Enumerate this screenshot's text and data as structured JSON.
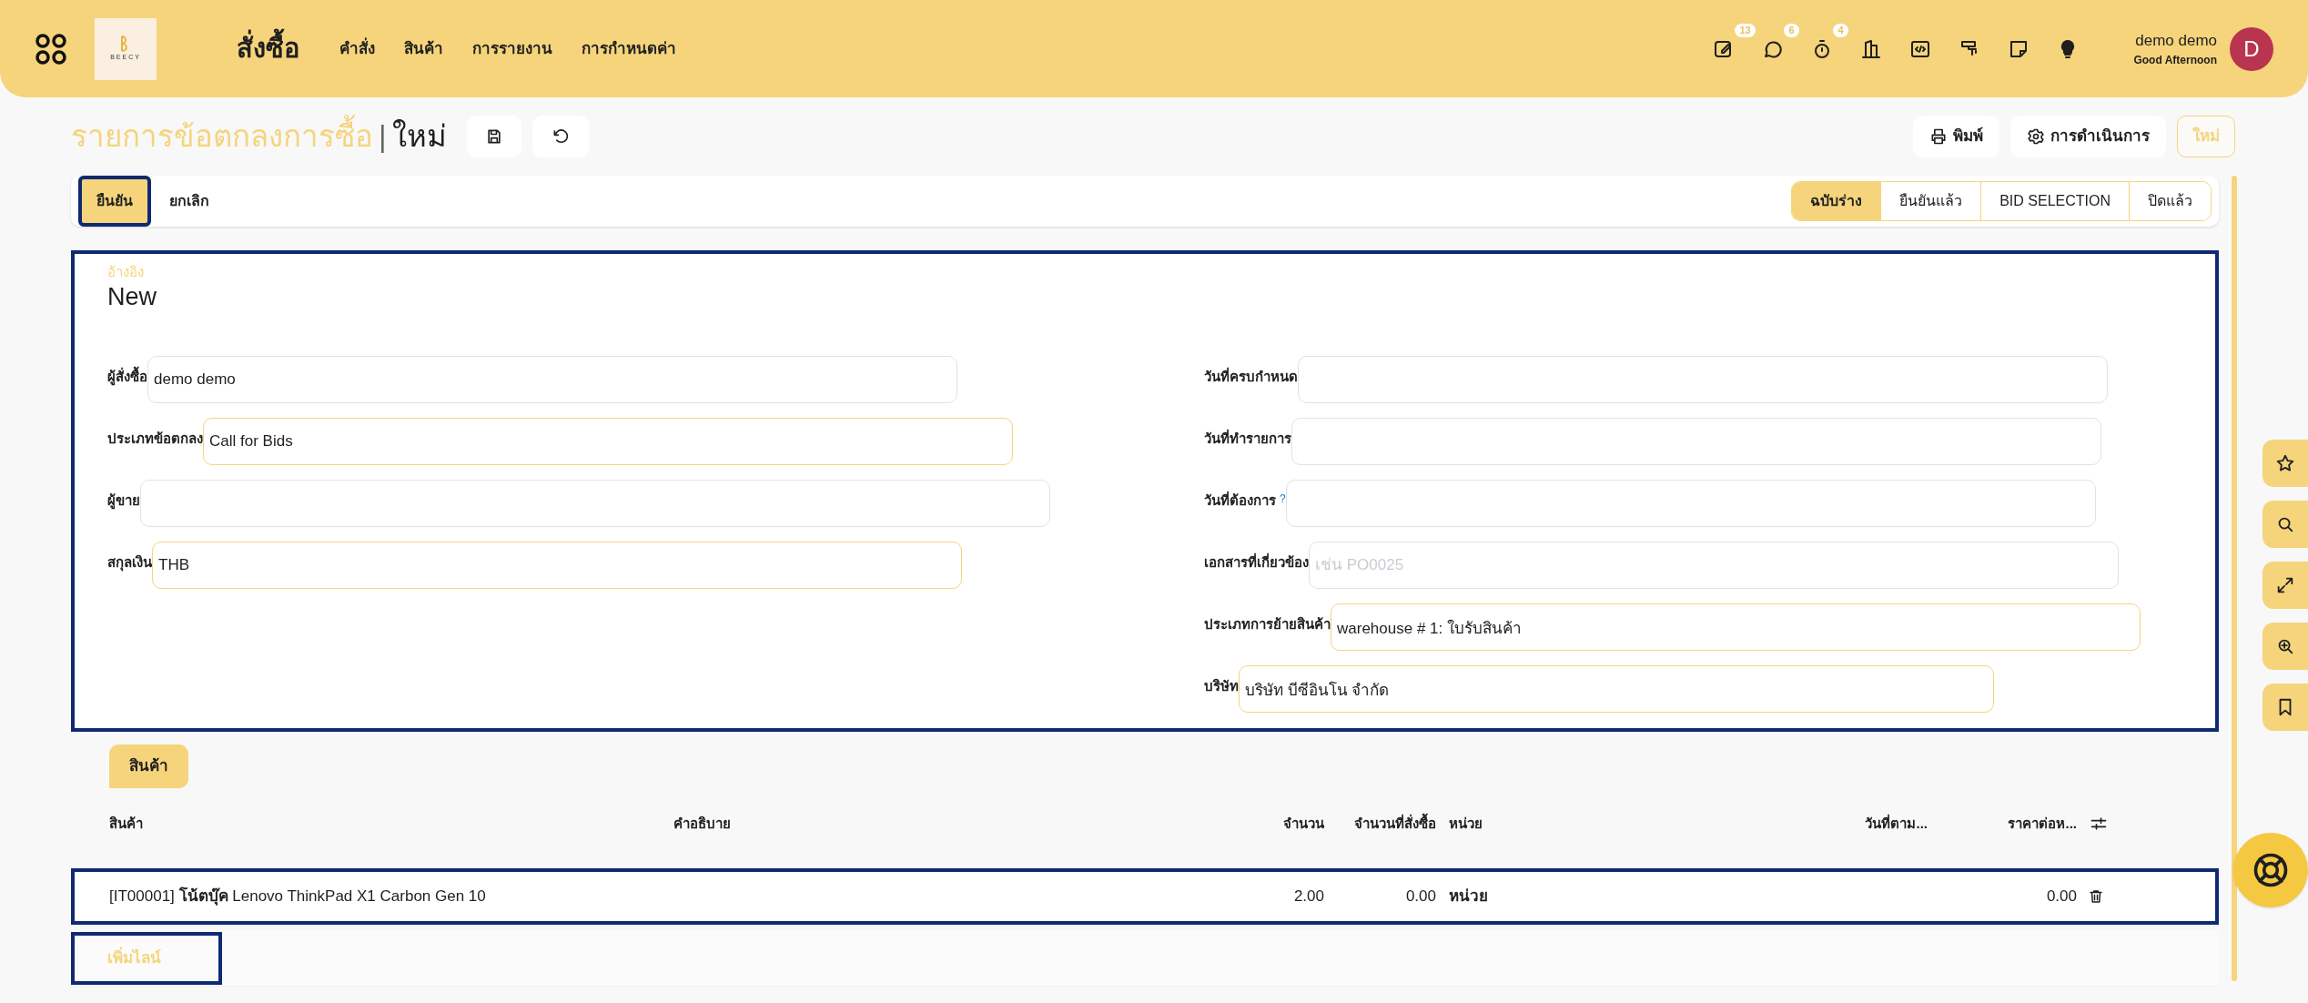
{
  "topbar": {
    "app_title": "สั่งซื้อ",
    "logo_text": "BEECY",
    "menu": [
      "คำสั่ง",
      "สินค้า",
      "การรายงาน",
      "การกำหนดค่า"
    ],
    "icons": [
      {
        "kind": "edit",
        "badge": "13"
      },
      {
        "kind": "chat",
        "badge": "6"
      },
      {
        "kind": "timer",
        "badge": "4"
      },
      {
        "kind": "building"
      },
      {
        "kind": "code"
      },
      {
        "kind": "paint"
      },
      {
        "kind": "note"
      },
      {
        "kind": "bulb"
      }
    ],
    "user": {
      "name": "demo demo",
      "greeting": "Good Afternoon",
      "initial": "D"
    }
  },
  "breadcrumb": {
    "parent": "รายการข้อตกลงการซื้อ",
    "separator": "|",
    "current": "ใหม่"
  },
  "actions": [
    {
      "kind": "print",
      "label": "พิมพ์"
    },
    {
      "kind": "gear",
      "label": "การดำเนินการ"
    },
    {
      "kind": "new",
      "label": "ใหม่"
    }
  ],
  "status_bar": {
    "buttons": [
      {
        "label": "ยืนยัน",
        "primary": true,
        "highlighted": true
      },
      {
        "label": "ยกเลิก",
        "primary": false,
        "highlighted": false
      }
    ],
    "stages": [
      {
        "label": "ฉบับร่าง",
        "selected": true
      },
      {
        "label": "ยืนยันแล้ว",
        "selected": false
      },
      {
        "label": "BID SELECTION",
        "selected": false
      },
      {
        "label": "ปิดแล้ว",
        "selected": false
      }
    ]
  },
  "form": {
    "highlighted": true,
    "reference_label": "อ้างอิง",
    "reference": "New",
    "left_fields": [
      {
        "label": "ผู้สั่งซื้อ",
        "value": "demo demo",
        "required": false
      },
      {
        "label": "ประเภทข้อตกลง",
        "value": "Call for Bids",
        "required": true
      },
      {
        "label": "ผู้ขาย",
        "required": false
      },
      {
        "label": "สกุลเงิน",
        "value": "THB",
        "required": true
      }
    ],
    "right_fields": [
      {
        "label": "วันที่ครบกำหนด",
        "required": false
      },
      {
        "label": "วันที่ทำรายการ",
        "required": false
      },
      {
        "label": "วันที่ต้องการ",
        "help_mark": "?",
        "required": false
      },
      {
        "label": "เอกสารที่เกี่ยวข้อง",
        "placeholder": "เช่น PO0025",
        "required": false
      },
      {
        "label": "ประเภทการย้ายสินค้า",
        "value": "warehouse # 1: ใบรับสินค้า",
        "required": true
      },
      {
        "label": "บริษัท",
        "value": "บริษัท บีซีอินโน จำกัด",
        "required": true
      }
    ]
  },
  "tabs": [
    {
      "label": "สินค้า",
      "selected": true
    }
  ],
  "table": {
    "columns": [
      "สินค้า",
      "คำอธิบาย",
      "จำนวน",
      "จำนวนที่สั่งซื้อ",
      "หน่วย",
      "วันที่ตาม...",
      "ราคาต่อห..."
    ],
    "rows": [
      {
        "highlighted": true,
        "code": "[IT00001]",
        "product": "โน้ตบุ๊ค",
        "model": "Lenovo ThinkPad X1 Carbon Gen 10",
        "quantity": "2.00",
        "ordered": "0.00",
        "unit": "หน่วย",
        "price": "0.00"
      }
    ],
    "add_line": {
      "label": "เพิ่มไลน์",
      "highlighted": true
    }
  },
  "side_tools": [
    {
      "kind": "star"
    },
    {
      "kind": "search"
    },
    {
      "kind": "expand"
    },
    {
      "kind": "zoom"
    },
    {
      "kind": "bookmark"
    }
  ]
}
